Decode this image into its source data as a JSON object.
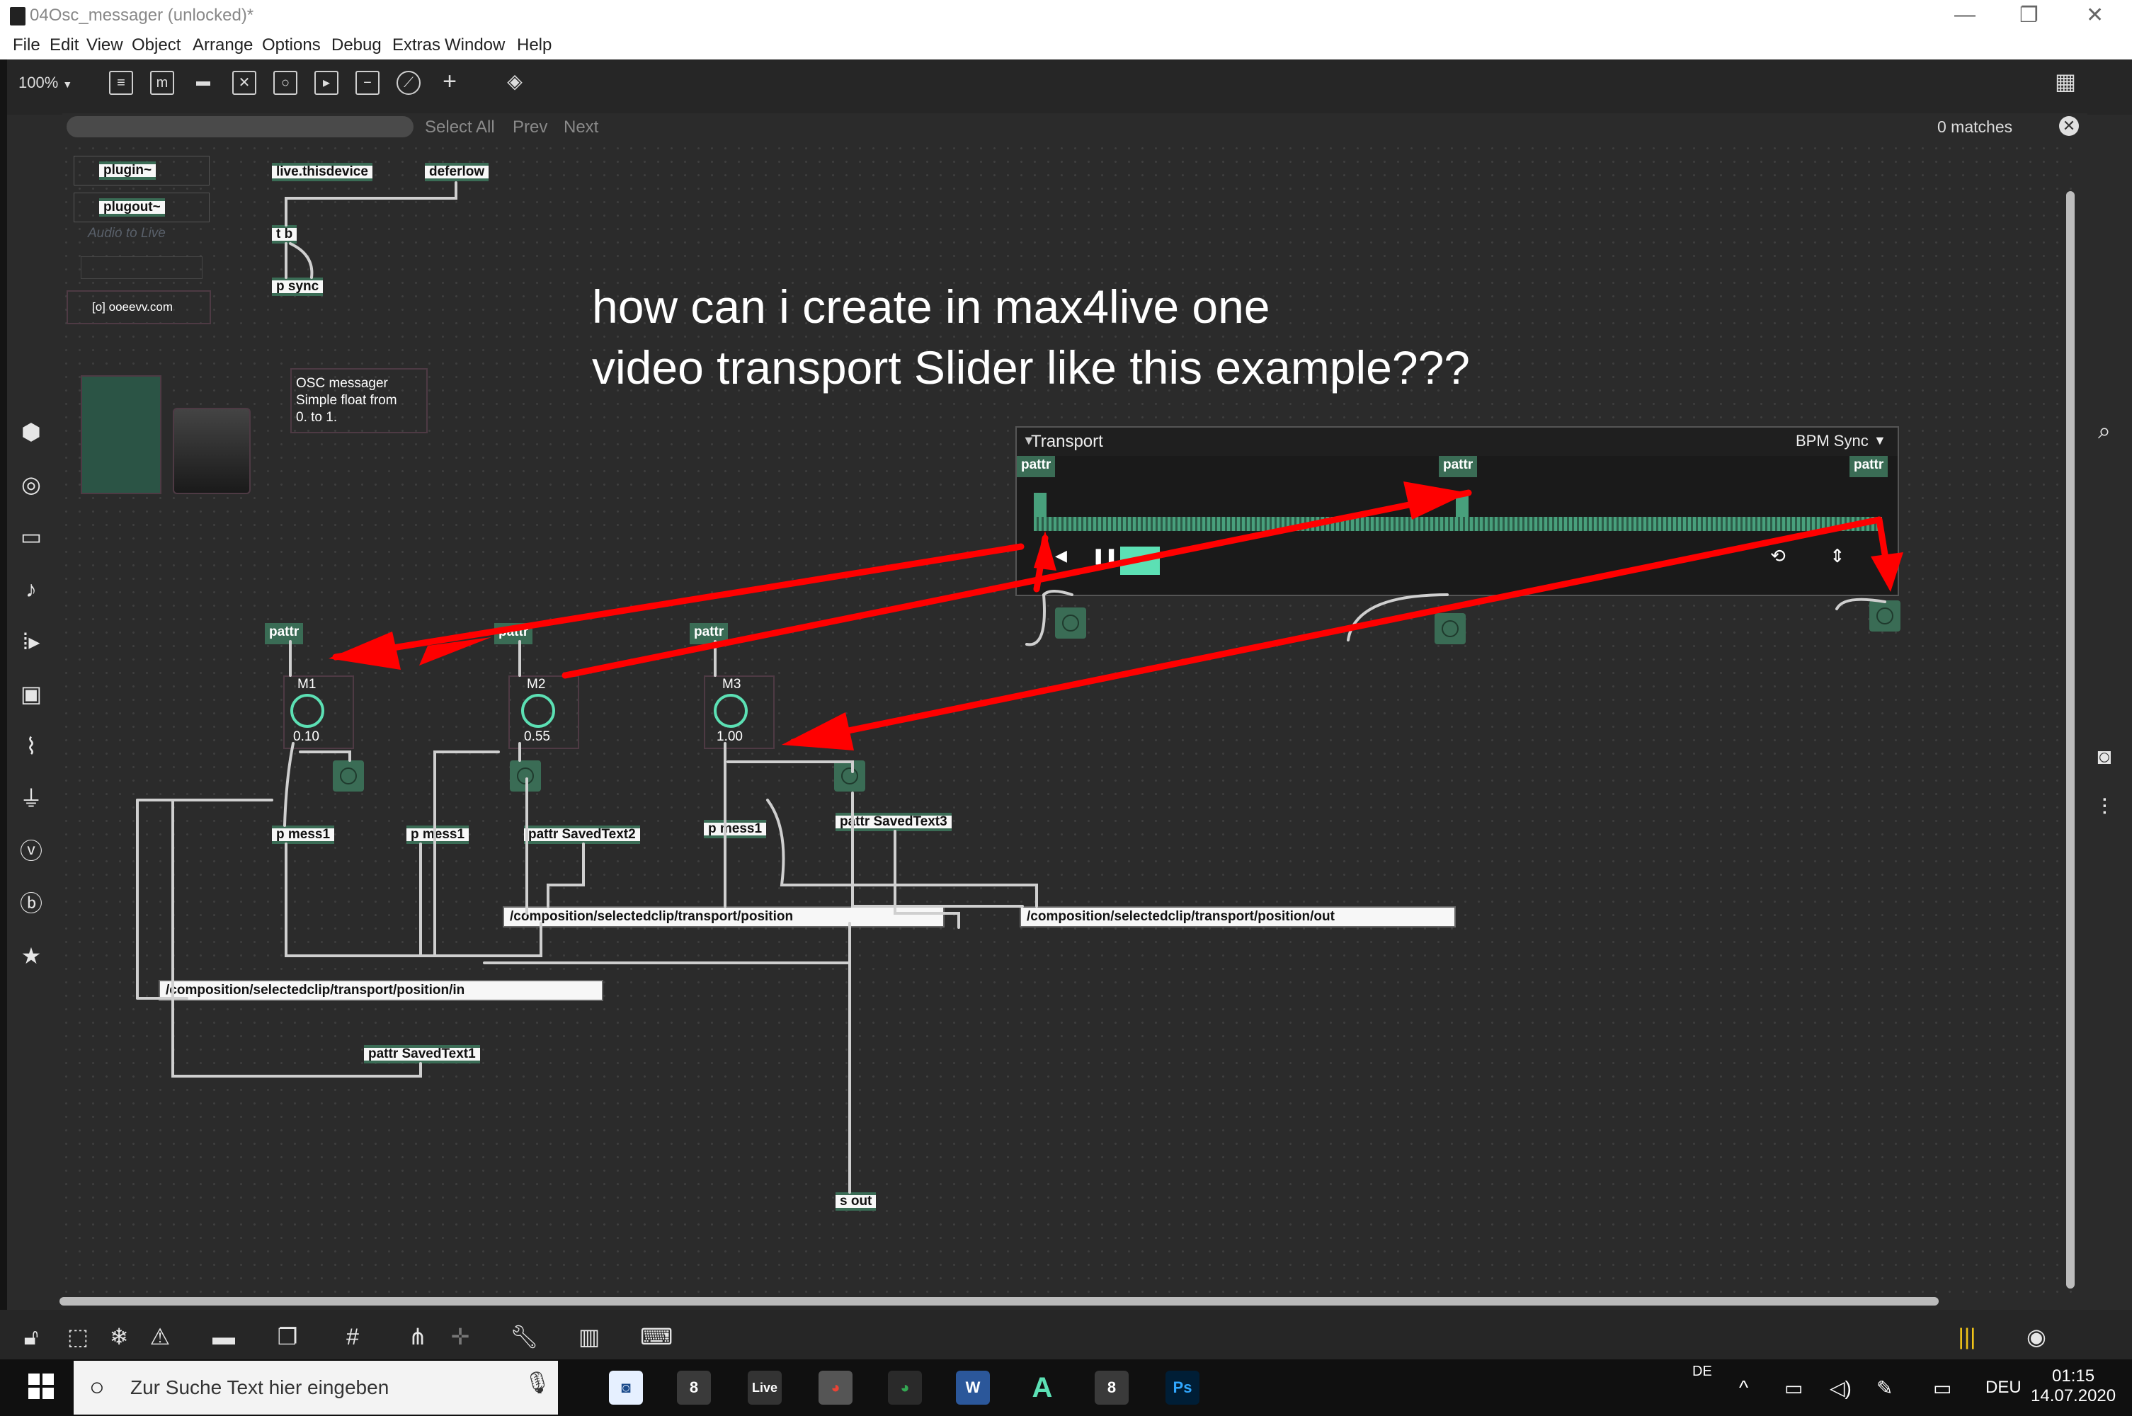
{
  "window": {
    "title": "04Osc_messager (unlocked)*",
    "minimize": "—",
    "restore": "❐",
    "close": "✕"
  },
  "menu": [
    "File",
    "Edit",
    "View",
    "Object",
    "Arrange",
    "Options",
    "Debug",
    "Extras",
    "Window",
    "Help"
  ],
  "toolbar": {
    "zoom": "100%",
    "zoom_arrow": "▼"
  },
  "find": {
    "select_all": "Select All",
    "prev": "Prev",
    "next": "Next",
    "matches": "0 matches",
    "close_glyph": "✕"
  },
  "objects": {
    "plugin": "plugin~",
    "plugout": "plugout~",
    "audio_to_live": "Audio to Live",
    "live_thisdevice": "live.thisdevice",
    "deferlow": "deferlow",
    "tb": "t b",
    "psync": "p sync",
    "ooeevv": "[o] ooeevv.com",
    "osc_comment_1": "OSC messager",
    "osc_comment_2": "Simple float from",
    "osc_comment_3": "0. to 1.",
    "pattr1": "pattr",
    "pattr2": "pattr",
    "pattr3": "pattr",
    "m1_label": "M1",
    "m2_label": "M2",
    "m3_label": "M3",
    "m1_value": "0.10",
    "m2_value": "0.55",
    "m3_value": "1.00",
    "pmess1_a": "p mess1",
    "pmess1_b": "p mess1",
    "pmess1_c": "p mess1",
    "pattr_saved2": "pattr SavedText2",
    "pattr_saved3": "pattr SavedText3",
    "pattr_saved1": "pattr SavedText1",
    "msg_position": "/composition/selectedclip/transport/position",
    "msg_position_out": "/composition/selectedclip/transport/position/out",
    "msg_position_in": "/composition/selectedclip/transport/position/in",
    "s_out": "s out"
  },
  "question": {
    "line1": "how can i create in max4live one",
    "line2": "video transport Slider like this example???"
  },
  "transport": {
    "title": "Transport",
    "bpm_sync": "BPM Sync",
    "pattr_left": "pattr",
    "pattr_mid": "pattr",
    "pattr_right": "pattr"
  },
  "taskbar": {
    "search_placeholder": "Zur Suche Text hier eingeben",
    "lang_top": "DE",
    "lang": "DEU",
    "time": "01:15",
    "date": "14.07.2020",
    "live_label": "Live",
    "ps_label": "Ps",
    "word_label": "W"
  },
  "colors": {
    "accent": "#3a6c55",
    "arrow": "#ff0000",
    "dial": "#5ce0b4"
  }
}
